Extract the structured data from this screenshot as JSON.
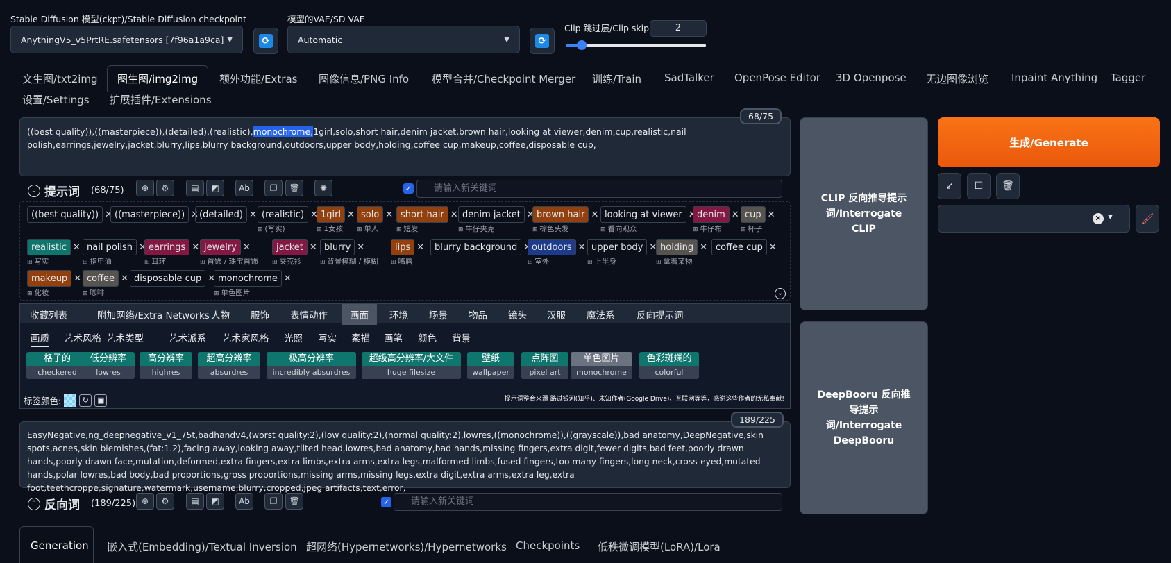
{
  "top": {
    "ckpt_label": "Stable Diffusion 模型(ckpt)/Stable Diffusion checkpoint",
    "ckpt_value": "AnythingV5_v5PrtRE.safetensors [7f96a1a9ca]",
    "vae_label": "模型的VAE/SD VAE",
    "vae_value": "Automatic",
    "clip_label": "Clip 跳过层/Clip skip",
    "clip_value": "2",
    "clip_slider_fraction": 0.1
  },
  "tabs": [
    "文生图/txt2img",
    "图生图/img2img",
    "额外功能/Extras",
    "图像信息/PNG Info",
    "模型合并/Checkpoint Merger",
    "训练/Train",
    "SadTalker",
    "OpenPose Editor",
    "3D Openpose",
    "无边图像浏览",
    "Inpaint Anything",
    "Tagger",
    "设置/Settings",
    "扩展插件/Extensions"
  ],
  "prompt": {
    "text_before": "((best quality)),((masterpiece)),(detailed),(realistic),",
    "text_highlight": "monochrome,",
    "text_after": "1girl,solo,short hair,denim jacket,brown hair,looking at viewer,denim,cup,realistic,nail polish,earrings,jewelry,jacket,blurry,lips,blurry background,outdoors,upper body,holding,coffee cup,makeup,coffee,disposable cup,",
    "counter": "68/75",
    "section_title": "提示词",
    "section_count": "(68/75)",
    "keyword_placeholder": "请输入新关键词"
  },
  "tags_row1": [
    {
      "t": "((best quality))",
      "tr": ""
    },
    {
      "t": "((masterpiece))",
      "tr": ""
    },
    {
      "t": "(detailed)",
      "tr": ""
    },
    {
      "t": "(realistic)",
      "tr": "(写实)"
    },
    {
      "t": "1girl",
      "tr": "1女孩"
    },
    {
      "t": "solo",
      "tr": "单人"
    },
    {
      "t": "short hair",
      "tr": "短发"
    },
    {
      "t": "denim jacket",
      "tr": "牛仔夹克"
    },
    {
      "t": "brown hair",
      "tr": "棕色头发"
    },
    {
      "t": "looking at viewer",
      "tr": "看向观众"
    },
    {
      "t": "denim",
      "tr": "牛仔布"
    },
    {
      "t": "cup",
      "tr": "杯子"
    }
  ],
  "tags_row2": [
    {
      "t": "realistic",
      "tr": "写实"
    },
    {
      "t": "nail polish",
      "tr": "指甲油"
    },
    {
      "t": "earrings",
      "tr": "耳环"
    },
    {
      "t": "jewelry",
      "tr": "首饰 / 珠宝首饰"
    },
    {
      "t": "jacket",
      "tr": "夹克衫"
    },
    {
      "t": "blurry",
      "tr": "背景模糊 / 模糊"
    },
    {
      "t": "lips",
      "tr": "嘴唇"
    },
    {
      "t": "blurry background",
      "tr": ""
    },
    {
      "t": "outdoors",
      "tr": "室外"
    },
    {
      "t": "upper body",
      "tr": "上半身"
    },
    {
      "t": "holding",
      "tr": "拿着某物"
    },
    {
      "t": "coffee cup",
      "tr": ""
    }
  ],
  "tags_row3": [
    {
      "t": "makeup",
      "tr": "化妆"
    },
    {
      "t": "coffee",
      "tr": "咖啡"
    },
    {
      "t": "disposable cup",
      "tr": ""
    },
    {
      "t": "monochrome",
      "tr": "单色图片"
    }
  ],
  "cat_tabs": [
    "收藏列表",
    "附加网络/Extra Networks",
    "人物",
    "服饰",
    "表情动作",
    "画面",
    "环境",
    "场景",
    "物品",
    "镜头",
    "汉服",
    "魔法系",
    "反向提示词"
  ],
  "sub_tabs": [
    "画质",
    "艺术风格",
    "艺术类型",
    "艺术派系",
    "艺术家风格",
    "光照",
    "写实",
    "素描",
    "画笔",
    "颜色",
    "背景"
  ],
  "chips": [
    {
      "a": "格子的",
      "b": "checkered"
    },
    {
      "a": "低分辨率",
      "b": "lowres"
    },
    {
      "a": "高分辨率",
      "b": "highres"
    },
    {
      "a": "超高分辨率",
      "b": "absurdres"
    },
    {
      "a": "极高分辨率",
      "b": "incredibly absurdres"
    },
    {
      "a": "超级高分辨率/大文件",
      "b": "huge filesize"
    },
    {
      "a": "壁纸",
      "b": "wallpaper"
    },
    {
      "a": "点阵图",
      "b": "pixel art"
    },
    {
      "a": "单色图片",
      "b": "monochrome"
    },
    {
      "a": "色彩斑斓的",
      "b": "colorful"
    }
  ],
  "tag_color_label": "标签颜色:",
  "credit": "提示词整合来源 路过银河(知乎)、未知作者(Google Drive)、互联网等等，感谢这些作者的无私奉献!",
  "negative": {
    "text": "EasyNegative,ng_deepnegative_v1_75t,badhandv4,(worst quality:2),(low quality:2),(normal quality:2),lowres,((monochrome)),((grayscale)),bad anatomy,DeepNegative,skin spots,acnes,skin blemishes,(fat:1.2),facing away,looking away,tilted head,lowres,bad anatomy,bad hands,missing fingers,extra digit,fewer digits,bad feet,poorly drawn hands,poorly drawn face,mutation,deformed,extra fingers,extra limbs,extra arms,extra legs,malformed limbs,fused fingers,too many fingers,long neck,cross-eyed,mutated hands,polar lowres,bad body,bad proportions,gross proportions,missing arms,missing legs,extra digit,extra arms,extra leg,extra foot,teethcroppe,signature,watermark,username,blurry,cropped,jpeg artifacts,text,error,",
    "counter": "189/225",
    "section_title": "反向词",
    "section_count": "(189/225)",
    "keyword_placeholder": "请输入新关键词"
  },
  "right": {
    "clip_btn": "CLIP 反向推导提示词/Interrogate CLIP",
    "deepbooru_btn": "DeepBooru 反向推导提示词/Interrogate DeepBooru",
    "generate_btn": "生成/Generate"
  },
  "bottom_tabs": [
    "Generation",
    "嵌入式(Embedding)/Textual Inversion",
    "超网络(Hypernetworks)/Hypernetworks",
    "Checkpoints",
    "低秩微调模型(LoRA)/Lora"
  ]
}
